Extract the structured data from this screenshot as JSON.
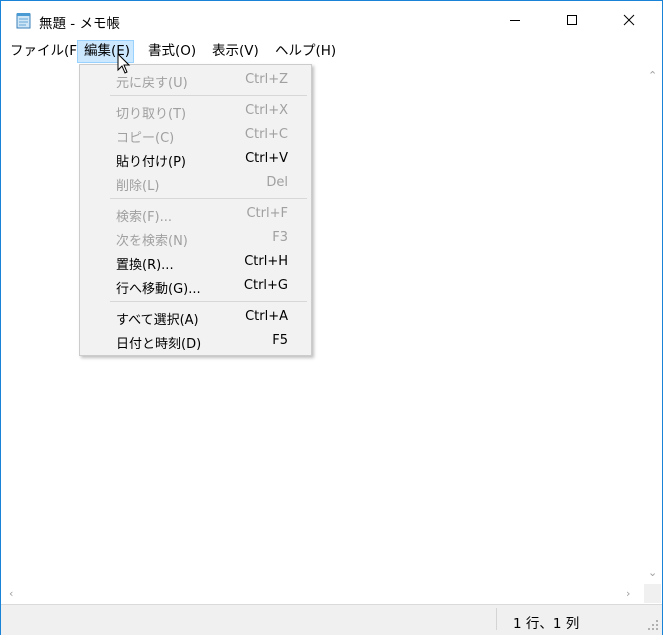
{
  "window": {
    "title": "無題 - メモ帳"
  },
  "icons": {
    "app": "notepad-icon",
    "minimize": "minimize-icon",
    "maximize": "maximize-icon",
    "close": "close-icon"
  },
  "menubar": [
    {
      "label": "ファイル(F)"
    },
    {
      "label": "編集(E)"
    },
    {
      "label": "書式(O)"
    },
    {
      "label": "表示(V)"
    },
    {
      "label": "ヘルプ(H)"
    }
  ],
  "edit_menu": [
    {
      "label": "元に戻す(U)",
      "shortcut": "Ctrl+Z",
      "enabled": false
    },
    {
      "label": "切り取り(T)",
      "shortcut": "Ctrl+X",
      "enabled": false
    },
    {
      "label": "コピー(C)",
      "shortcut": "Ctrl+C",
      "enabled": false
    },
    {
      "label": "貼り付け(P)",
      "shortcut": "Ctrl+V",
      "enabled": true
    },
    {
      "label": "削除(L)",
      "shortcut": "Del",
      "enabled": false
    },
    {
      "label": "検索(F)...",
      "shortcut": "Ctrl+F",
      "enabled": false
    },
    {
      "label": "次を検索(N)",
      "shortcut": "F3",
      "enabled": false
    },
    {
      "label": "置換(R)...",
      "shortcut": "Ctrl+H",
      "enabled": true
    },
    {
      "label": "行へ移動(G)...",
      "shortcut": "Ctrl+G",
      "enabled": true
    },
    {
      "label": "すべて選択(A)",
      "shortcut": "Ctrl+A",
      "enabled": true
    },
    {
      "label": "日付と時刻(D)",
      "shortcut": "F5",
      "enabled": true
    }
  ],
  "editor": {
    "text": ""
  },
  "statusbar": {
    "position": "1 行、1 列"
  },
  "colors": {
    "accent": "#1883d7",
    "menu_highlight": "#cce8ff",
    "disabled_text": "#a0a0a0",
    "menu_bg": "#f2f2f2"
  }
}
